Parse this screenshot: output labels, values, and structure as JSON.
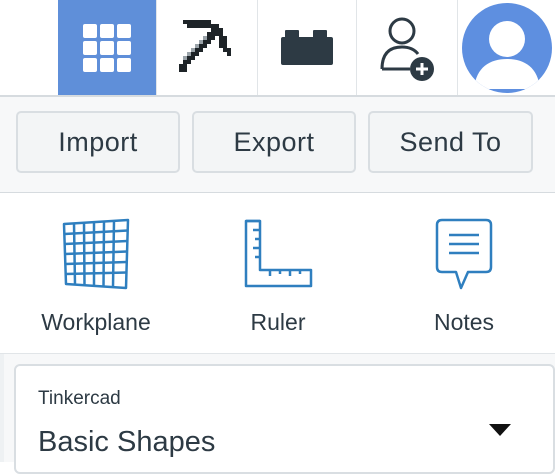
{
  "topbar": {
    "buttons": [
      {
        "icon": "grid-icon",
        "active": true
      },
      {
        "icon": "pickaxe-icon",
        "active": false
      },
      {
        "icon": "brick-icon",
        "active": false
      },
      {
        "icon": "add-user-icon",
        "active": false
      }
    ],
    "avatar_icon": "avatar-icon"
  },
  "toolbar": {
    "import_label": "Import",
    "export_label": "Export",
    "send_to_label": "Send To"
  },
  "tools": {
    "workplane_label": "Workplane",
    "ruler_label": "Ruler",
    "notes_label": "Notes"
  },
  "shapes_panel": {
    "subtitle": "Tinkercad",
    "title": "Basic Shapes"
  },
  "colors": {
    "active_nav": "#5f8fd9",
    "icon_blue": "#2f7fbf",
    "icon_dark": "#2d3a44",
    "avatar_bg": "#5e8fe0"
  }
}
